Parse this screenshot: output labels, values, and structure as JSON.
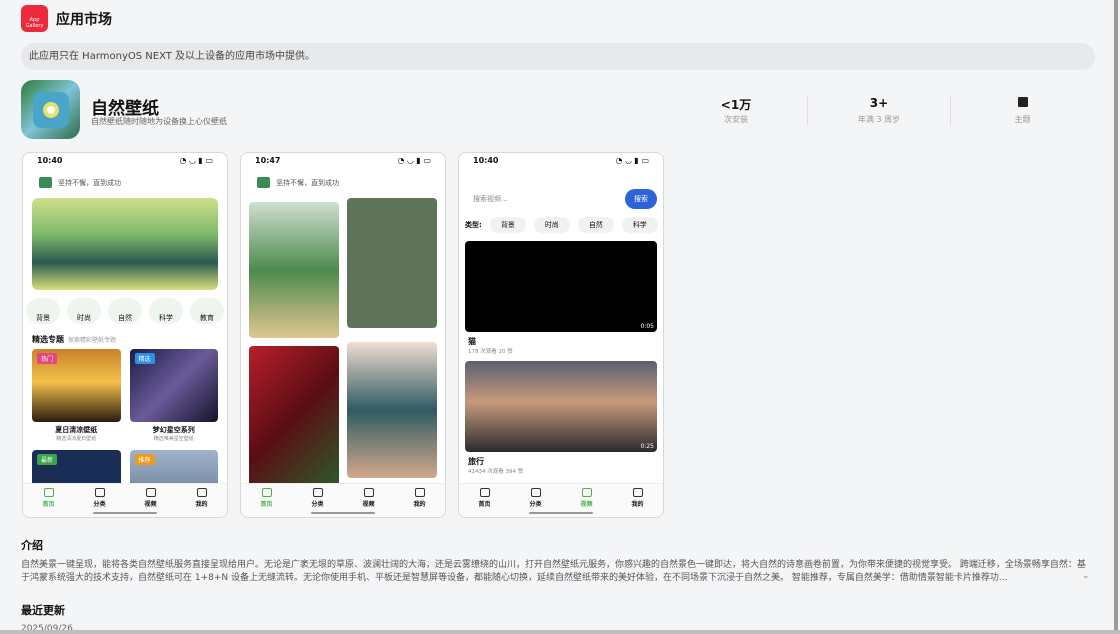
{
  "store": {
    "logo_text": "AppGallery",
    "title": "应用市场"
  },
  "notice": "此应用只在 HarmonyOS NEXT 及以上设备的应用市场中提供。",
  "app": {
    "name": "自然壁纸",
    "subtitle": "自然壁纸随时随地为设备换上心仪壁纸"
  },
  "stats": [
    {
      "value": "<1万",
      "label": "次安装"
    },
    {
      "value": "3+",
      "label": "年满 3 周岁"
    },
    {
      "value": "",
      "icon": "book-icon",
      "label": "主题"
    }
  ],
  "screens": {
    "s1": {
      "time": "10:40",
      "header": "坚持不懈，直到成功",
      "cats": [
        "背景",
        "时尚",
        "自然",
        "科学",
        "教育"
      ],
      "section": "精选专题",
      "section_sub": "探索精彩壁纸专题",
      "cards": [
        {
          "tag": "热门",
          "title": "夏日清凉壁纸",
          "sub": "精选清凉夏日壁纸"
        },
        {
          "tag": "精选",
          "title": "梦幻星空系列",
          "sub": "精选唯美星空壁纸"
        },
        {
          "tag": "最新"
        },
        {
          "tag": "推荐"
        }
      ]
    },
    "s2": {
      "time": "10:47",
      "header": "坚持不懈，直到成功"
    },
    "s3": {
      "time": "10:40",
      "search_placeholder": "搜索视频...",
      "search_btn": "搜索",
      "types_label": "类型:",
      "types": [
        "背景",
        "时尚",
        "自然",
        "科学"
      ],
      "videos": [
        {
          "title": "猫",
          "meta": "178 次观看   20 赞",
          "duration": "0:05"
        },
        {
          "title": "旅行",
          "meta": "41434 次观看   394 赞",
          "duration": "0:25"
        }
      ]
    },
    "nav": [
      "首页",
      "分类",
      "视频",
      "我的"
    ]
  },
  "intro": {
    "heading": "介绍",
    "text": "自然美景一键呈现，能将各类自然壁纸服务直接呈现给用户。无论是广袤无垠的草原、波澜壮阔的大海，还是云雾缭绕的山川，打开自然壁纸元服务，你感兴趣的自然景色一键即达，将大自然的诗意画卷前置，为你带来便捷的视觉享受。 跨端迁移，全场景畅享自然：基于鸿蒙系统强大的技术支持，自然壁纸可在 1+8+N 设备上无缝流转。无论你使用手机、平板还是智慧屏等设备，都能随心切换，延续自然壁纸带来的美好体验，在不同场景下沉浸于自然之美。 智能推荐，专属自然美学：借助情景智能卡片推荐功...",
    "expand": "⌄"
  },
  "updates": {
    "heading": "最近更新",
    "date": "2025/09/26"
  }
}
